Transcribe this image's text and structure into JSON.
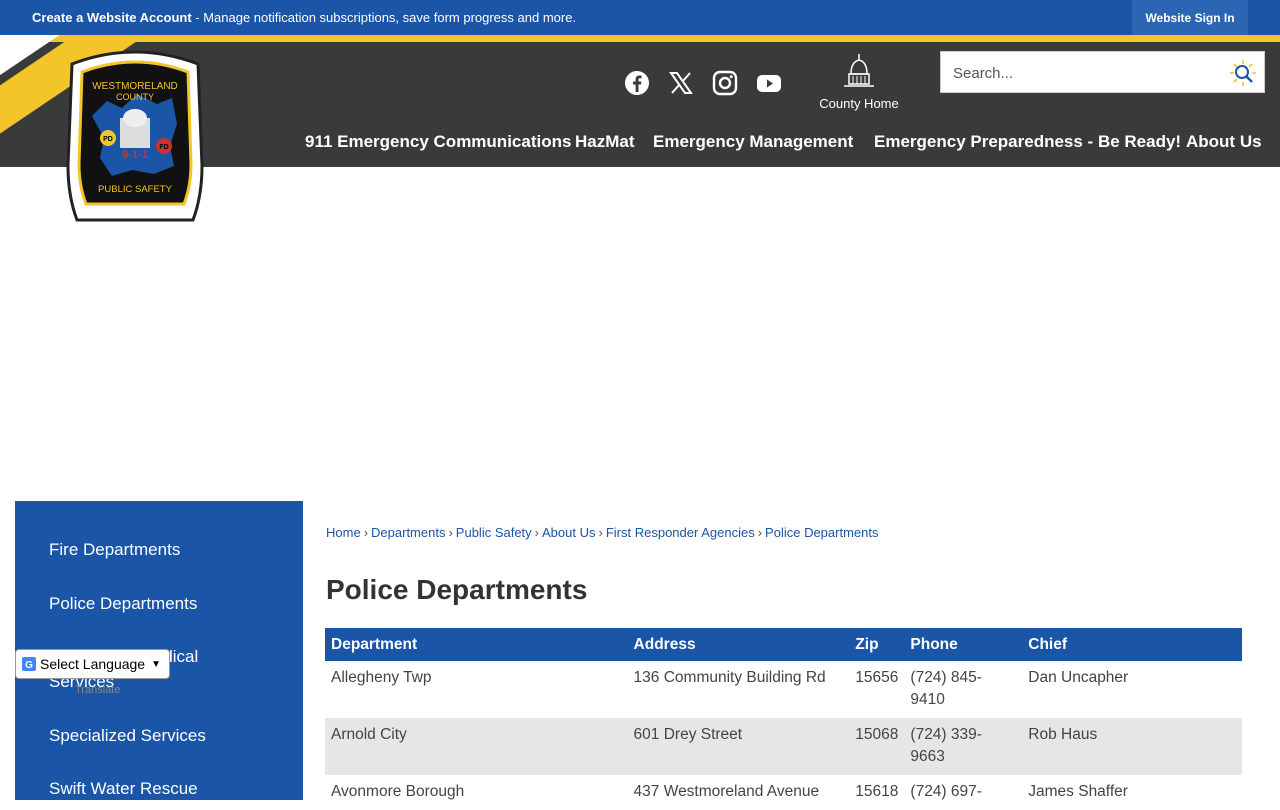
{
  "topbar": {
    "account_link": "Create a Website Account",
    "account_text": " - Manage notification subscriptions, save form progress and more.",
    "signin_label": "Website Sign In"
  },
  "logo": {
    "line1": "WESTMORELAND",
    "line2": "COUNTY",
    "pd": "PD",
    "fd": "FD",
    "num": "9-1-1",
    "bottom": "PUBLIC SAFETY"
  },
  "header": {
    "social": [
      "facebook-icon",
      "x-icon",
      "instagram-icon",
      "youtube-icon"
    ],
    "county_home_label": "County Home",
    "search_placeholder": "Search...",
    "nav": [
      "911 Emergency Communications",
      "HazMat",
      "Emergency Management",
      "Emergency Preparedness - Be Ready!",
      "About Us"
    ]
  },
  "sidebar": {
    "items": [
      "Fire Departments",
      "Police Departments",
      "Emergency Medical",
      "Services",
      "Specialized Services",
      "Swift Water Rescue"
    ],
    "translate_label": "Select Language",
    "powered_by": "Translate"
  },
  "breadcrumb": [
    "Home",
    "Departments",
    "Public Safety",
    "About Us",
    "First Responder Agencies",
    "Police Departments"
  ],
  "page_title": "Police Departments",
  "table": {
    "headers": [
      "Department",
      "Address",
      "Zip",
      "Phone",
      "Chief"
    ],
    "rows": [
      [
        "Allegheny Twp",
        "136 Community Building Rd",
        "15656",
        "(724) 845-9410",
        "Dan Uncapher"
      ],
      [
        "Arnold City",
        "601 Drey Street",
        "15068",
        "(724) 339-9663",
        "Rob Haus"
      ],
      [
        "Avonmore Borough",
        "437 Westmoreland Avenue",
        "15618",
        "(724) 697-",
        "James Shaffer"
      ]
    ]
  },
  "colors": {
    "brand_blue": "#1a55a8",
    "header_dark": "#3a3a3a",
    "accent_yellow": "#f3c528"
  }
}
